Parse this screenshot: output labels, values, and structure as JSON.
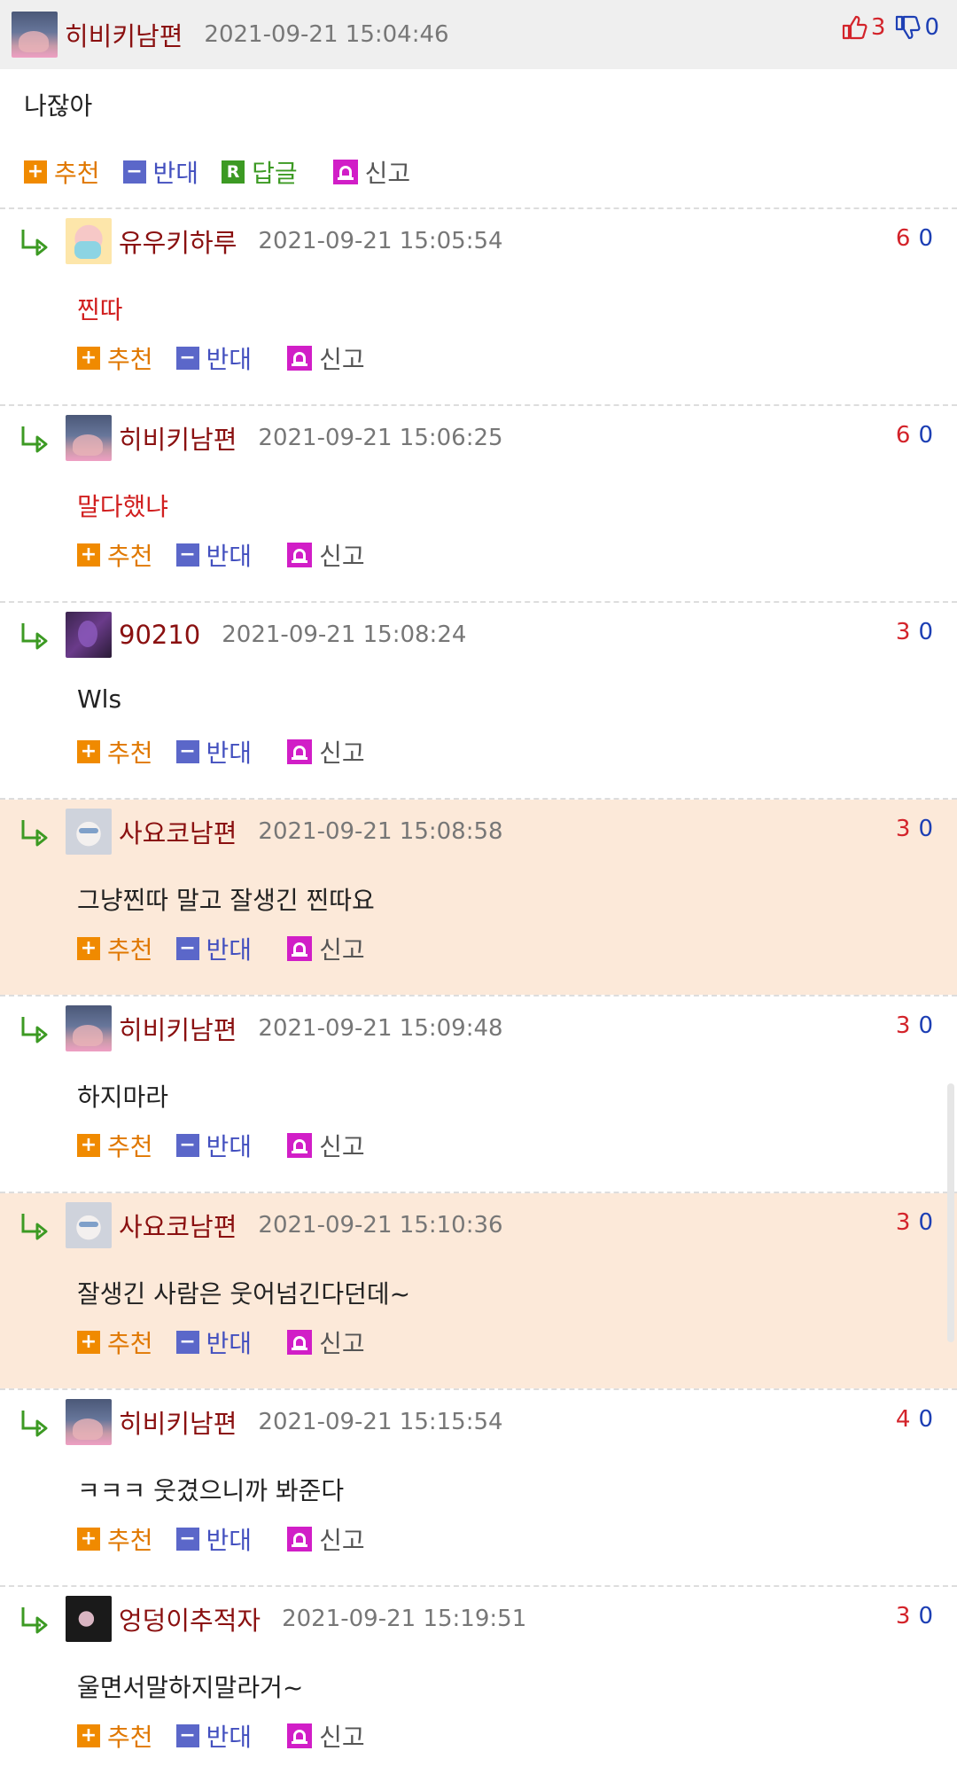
{
  "top_comment": {
    "nick": "히비키남편",
    "date": "2021-09-21 15:04:46",
    "up": "3",
    "down": "0",
    "body": "나잖아",
    "actions": {
      "recommend": "추천",
      "oppose": "반대",
      "reply": "답글",
      "report": "신고"
    },
    "icons": {
      "recommend": "+",
      "oppose": "−",
      "reply": "R"
    }
  },
  "replies": [
    {
      "nick": "유우키하루",
      "date": "2021-09-21 15:05:54",
      "up": "6",
      "down": "0",
      "body": "찐따"
    },
    {
      "nick": "히비키남편",
      "date": "2021-09-21 15:06:25",
      "up": "6",
      "down": "0",
      "body": "말다했냐"
    },
    {
      "nick": "90210",
      "date": "2021-09-21 15:08:24",
      "up": "3",
      "down": "0",
      "body": "Wls"
    },
    {
      "nick": "사요코남편",
      "date": "2021-09-21 15:08:58",
      "up": "3",
      "down": "0",
      "body": "그냥찐따 말고 잘생긴 찐따요"
    },
    {
      "nick": "히비키남편",
      "date": "2021-09-21 15:09:48",
      "up": "3",
      "down": "0",
      "body": "하지마라"
    },
    {
      "nick": "사요코남편",
      "date": "2021-09-21 15:10:36",
      "up": "3",
      "down": "0",
      "body": "잘생긴 사람은 웃어넘긴다던데~"
    },
    {
      "nick": "히비키남편",
      "date": "2021-09-21 15:15:54",
      "up": "4",
      "down": "0",
      "body": "ㅋㅋㅋ 웃겼으니까 봐준다"
    },
    {
      "nick": "엉덩이추적자",
      "date": "2021-09-21 15:19:51",
      "up": "3",
      "down": "0",
      "body": "울면서말하지말라거~"
    }
  ],
  "reply_actions": {
    "recommend": "추천",
    "oppose": "반대",
    "report": "신고"
  },
  "colors": {
    "nick": "#8a1010",
    "up": "#d3232a",
    "down": "#1d3fb4",
    "recommend": "#f08a00",
    "oppose": "#5b67c9",
    "reply": "#3c9a23",
    "report_icon": "#d11ec7",
    "highlight_bg": "#fce9d9",
    "red_body": "#d11f1f"
  }
}
